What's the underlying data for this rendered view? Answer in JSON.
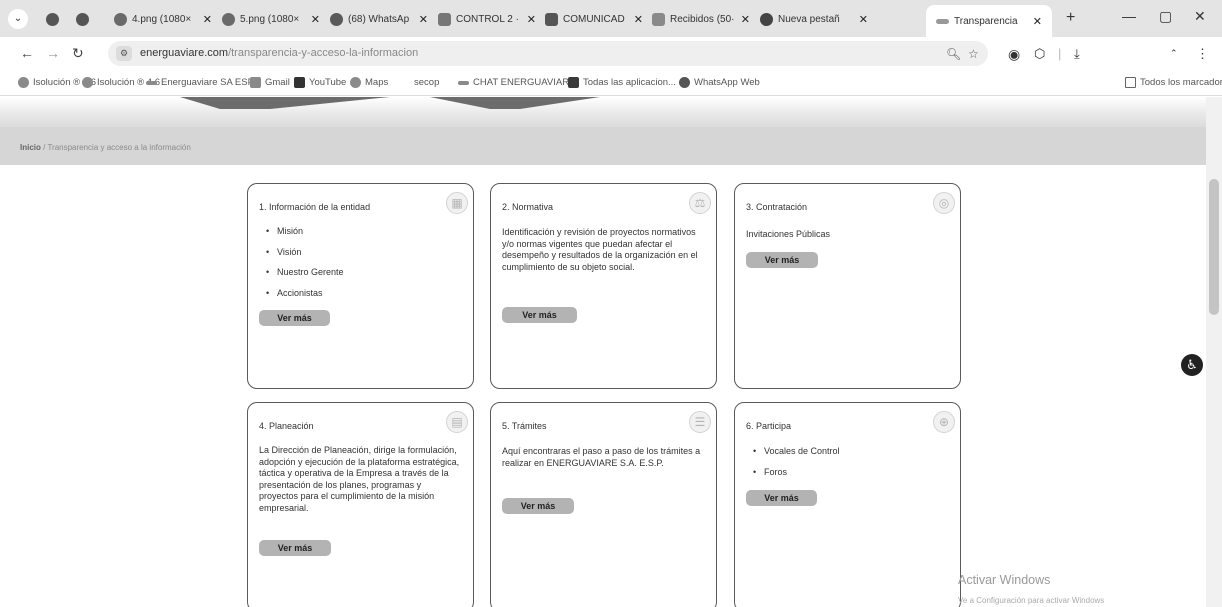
{
  "browser": {
    "tabs": [
      {
        "label": "4.png (1080×",
        "icon": "photo-icon",
        "active": false
      },
      {
        "label": "5.png (1080×",
        "icon": "photo-icon",
        "active": false
      },
      {
        "label": "(68) WhatsAp",
        "icon": "whatsapp-icon",
        "active": false
      },
      {
        "label": "CONTROL 2 ·",
        "icon": "drive-icon",
        "active": false
      },
      {
        "label": "COMUNICAD",
        "icon": "chat-icon",
        "active": false
      },
      {
        "label": "Recibidos (50·",
        "icon": "gmail-icon",
        "active": false
      },
      {
        "label": "Nueva pestañ",
        "icon": "chrome-icon",
        "active": false
      },
      {
        "label": "Transparencia",
        "icon": "energuaviare-icon",
        "active": true
      }
    ],
    "url_host": "energuaviare.com",
    "url_path": "/transparencia-y-acceso-la-informacion",
    "bookmarks": [
      {
        "label": "Isolución ® 4.6",
        "icon": "isolucion-icon"
      },
      {
        "label": "Isolución ® 4.6",
        "icon": "isolucion-icon"
      },
      {
        "label": "Energuaviare SA ESP",
        "icon": "energuaviare-icon"
      },
      {
        "label": "Gmail",
        "icon": "gmail-icon"
      },
      {
        "label": "YouTube",
        "icon": "youtube-icon"
      },
      {
        "label": "Maps",
        "icon": "maps-icon"
      },
      {
        "label": "secop",
        "icon": "none"
      },
      {
        "label": "CHAT ENERGUAVIARE",
        "icon": "energuaviare-icon"
      },
      {
        "label": "Todas las aplicacion...",
        "icon": "apps-icon"
      },
      {
        "label": "WhatsApp Web",
        "icon": "whatsapp-icon"
      }
    ],
    "all_bookmarks": "Todos los marcadores"
  },
  "breadcrumb": {
    "home": "Inicio",
    "separator": "/",
    "current": "Transparencia y acceso a la información"
  },
  "cards": [
    {
      "title": "1. Información de la entidad",
      "items": [
        "Misión",
        "Visión",
        "Nuestro Gerente",
        "Accionistas"
      ],
      "button": "Ver más",
      "icon": "building-icon"
    },
    {
      "title": "2. Normativa",
      "text": "Identificación y revisión de proyectos normativos y/o normas vigentes que puedan afectar el desempeño y resultados de la organización en el cumplimiento de su objeto social.",
      "button": "Ver más",
      "icon": "scales-icon"
    },
    {
      "title": "3. Contratación",
      "text": "Invitaciones Públicas",
      "button": "Ver más",
      "icon": "contract-icon"
    },
    {
      "title": "4. Planeación",
      "text": "La Dirección de Planeación, dirige la formulación, adopción y ejecución de la plataforma estratégica, táctica y operativa de la Empresa a través de la presentación de los planes, programas y proyectos para el cumplimiento de la misión empresarial.",
      "button": "Ver más",
      "icon": "document-icon"
    },
    {
      "title": "5. Trámites",
      "text": "Aquí encontraras el paso a paso de los trámites a realizar en ENERGUAVIARE S.A. E.S.P.",
      "button": "Ver más",
      "icon": "stack-icon"
    },
    {
      "title": "6. Participa",
      "items": [
        "Vocales de Control",
        "Foros"
      ],
      "button": "Ver más",
      "icon": "globe-icon"
    }
  ],
  "windows_watermark": {
    "title": "Activar Windows",
    "subtitle": "Ve a Configuración para activar Windows"
  }
}
